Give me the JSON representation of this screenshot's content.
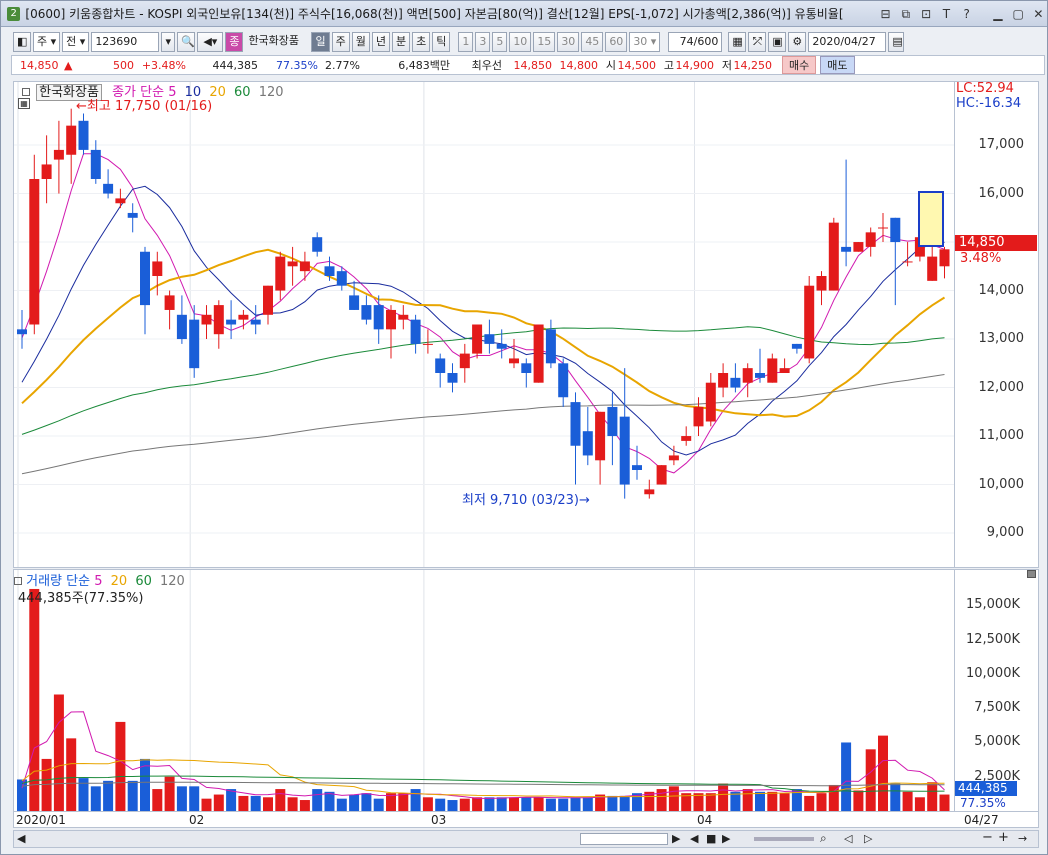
{
  "window": {
    "icon": "2",
    "title": "[0600] 키움종합차트 - KOSPI 외국인보유[134(천)] 주식수[16,068(천)] 액면[500] 자본금[80(억)] 결산[12월] EPS[-1,072] 시가총액[2,386(억)] 유통비율[",
    "controls": [
      "⊟",
      "⧉",
      "⊡",
      "T",
      "?",
      "▭",
      "▭",
      "✕"
    ]
  },
  "toolbar": {
    "market": "주",
    "prev": "전",
    "code": "123690",
    "stock_name": "한국화장품",
    "badge": "종",
    "periods": [
      "일",
      "주",
      "월",
      "년",
      "분",
      "초",
      "틱"
    ],
    "active_period": "일",
    "intervals": [
      "1",
      "3",
      "5",
      "10",
      "15",
      "30",
      "45",
      "60"
    ],
    "interval_value": "30",
    "count": "74",
    "count_total": "/600",
    "date": "2020/04/27"
  },
  "quote": {
    "price": "14,850",
    "change_arrow": "▲",
    "change": "500",
    "change_pct": "+3.48%",
    "volume": "444,385",
    "vol_ratio": "77.35%",
    "turnover": "2.77%",
    "amount": "6,483백만",
    "best_ask_label": "최우선",
    "best_ask": "14,850",
    "best_bid": "14,800",
    "open_label": "시",
    "open": "14,500",
    "high_label": "고",
    "high": "14,900",
    "low_label": "저",
    "low": "14,250",
    "buy": "매수",
    "sell": "매도"
  },
  "legend": {
    "stock": "한국화장품",
    "close_label": "종가 단순",
    "ma": [
      "5",
      "10",
      "20",
      "60",
      "120"
    ],
    "vol_label": "거래량 단순",
    "vol_ma": [
      "5",
      "20",
      "60",
      "120"
    ],
    "vol_now": "444,385주(77.35%)"
  },
  "annotations": {
    "high": "최고 17,750 (01/16)",
    "low": "최저 9,710 (03/23)",
    "lc": "LC:52.94",
    "hc": "HC:-16.34",
    "price_tag": "14,850",
    "pct_tag": "3.48%",
    "vol_tag": "444,385",
    "vol_pct_tag": "77.35%"
  },
  "price_axis": [
    "17,000",
    "16,000",
    "15,000",
    "14,000",
    "13,000",
    "12,000",
    "11,000",
    "10,000",
    "9,000"
  ],
  "volume_axis": [
    "15,000K",
    "12,500K",
    "10,000K",
    "7,500K",
    "5,000K",
    "2,500K"
  ],
  "x_axis": [
    "2020/01",
    "02",
    "03",
    "04",
    "04/27"
  ],
  "colors": {
    "up": "#e31b1b",
    "down": "#1a5ed8",
    "ma5": "#d11ab0",
    "ma10": "#1a2c9e",
    "ma20": "#e8a500",
    "ma60": "#1b8a3a",
    "ma120": "#777777"
  },
  "chart_data": {
    "type": "candlestick",
    "x_start": "2020/01/02",
    "x_end": "2020/04/27",
    "ylim": [
      8300,
      18300
    ],
    "series": [
      {
        "name": "한국화장품",
        "ohlc": [
          [
            13200,
            13600,
            12800,
            13100
          ],
          [
            13300,
            16800,
            13100,
            16300
          ],
          [
            16300,
            17200,
            15800,
            16600
          ],
          [
            16700,
            17500,
            16000,
            16900
          ],
          [
            16800,
            17750,
            16200,
            17400
          ],
          [
            17500,
            17650,
            16800,
            16900
          ],
          [
            16900,
            17100,
            16200,
            16300
          ],
          [
            16200,
            16500,
            15900,
            16000
          ],
          [
            15800,
            16100,
            15700,
            15900
          ],
          [
            15600,
            15800,
            15200,
            15500
          ],
          [
            14800,
            14900,
            13100,
            13700
          ],
          [
            14300,
            14800,
            13900,
            14600
          ],
          [
            13600,
            14000,
            13200,
            13900
          ],
          [
            13500,
            13900,
            12900,
            13000
          ],
          [
            13400,
            13700,
            12200,
            12400
          ],
          [
            13300,
            13700,
            13000,
            13500
          ],
          [
            13100,
            13800,
            12800,
            13700
          ],
          [
            13400,
            13800,
            13000,
            13300
          ],
          [
            13400,
            13600,
            13200,
            13500
          ],
          [
            13400,
            13700,
            13100,
            13300
          ],
          [
            13500,
            14100,
            13300,
            14100
          ],
          [
            14000,
            14800,
            13800,
            14700
          ],
          [
            14500,
            14900,
            14100,
            14600
          ],
          [
            14400,
            14800,
            14200,
            14600
          ],
          [
            15100,
            15200,
            14700,
            14800
          ],
          [
            14500,
            14700,
            14200,
            14300
          ],
          [
            14400,
            14500,
            14000,
            14100
          ],
          [
            13900,
            14200,
            13600,
            13600
          ],
          [
            13700,
            13900,
            13300,
            13400
          ],
          [
            13700,
            13900,
            12900,
            13200
          ],
          [
            13200,
            13700,
            12600,
            13600
          ],
          [
            13400,
            13700,
            13200,
            13500
          ],
          [
            13400,
            13500,
            12700,
            12900
          ],
          [
            12900,
            13200,
            12700,
            12900
          ],
          [
            12600,
            12700,
            12000,
            12300
          ],
          [
            12300,
            12500,
            11900,
            12100
          ],
          [
            12400,
            12900,
            12100,
            12700
          ],
          [
            12700,
            13300,
            12600,
            13300
          ],
          [
            13100,
            13400,
            12700,
            12900
          ],
          [
            12900,
            13200,
            12600,
            12800
          ],
          [
            12500,
            13000,
            12400,
            12600
          ],
          [
            12500,
            12600,
            12000,
            12300
          ],
          [
            12100,
            13300,
            12100,
            13300
          ],
          [
            13200,
            13400,
            12400,
            12500
          ],
          [
            12500,
            12600,
            11600,
            11800
          ],
          [
            11700,
            11900,
            10000,
            10800
          ],
          [
            11100,
            11600,
            10400,
            10600
          ],
          [
            10500,
            11500,
            10000,
            11500
          ],
          [
            11600,
            11900,
            10400,
            11000
          ],
          [
            11400,
            12400,
            9710,
            10000
          ],
          [
            10400,
            10800,
            10100,
            10300
          ],
          [
            9800,
            10100,
            9710,
            9900
          ],
          [
            10000,
            10400,
            10000,
            10400
          ],
          [
            10500,
            10800,
            10400,
            10600
          ],
          [
            10900,
            11200,
            10800,
            11000
          ],
          [
            11200,
            11800,
            11000,
            11600
          ],
          [
            11300,
            12300,
            11200,
            12100
          ],
          [
            12000,
            12500,
            11800,
            12300
          ],
          [
            12200,
            12500,
            11900,
            12000
          ],
          [
            12100,
            12500,
            11800,
            12400
          ],
          [
            12300,
            12800,
            12100,
            12200
          ],
          [
            12100,
            12700,
            12100,
            12600
          ],
          [
            12300,
            12600,
            12300,
            12400
          ],
          [
            12900,
            12900,
            12700,
            12800
          ],
          [
            12600,
            14300,
            12500,
            14100
          ],
          [
            14000,
            14400,
            13700,
            14300
          ],
          [
            14000,
            15500,
            14000,
            15400
          ],
          [
            14900,
            16700,
            14500,
            14800
          ],
          [
            14800,
            15000,
            14800,
            15000
          ],
          [
            14900,
            15300,
            14700,
            15200
          ],
          [
            15300,
            15600,
            15000,
            15300
          ],
          [
            15500,
            15500,
            13700,
            15000
          ],
          [
            14600,
            15000,
            14500,
            14600
          ],
          [
            14700,
            15100,
            14600,
            15100
          ],
          [
            14200,
            15000,
            14200,
            14700
          ],
          [
            14500,
            14900,
            14250,
            14850
          ]
        ]
      }
    ],
    "volume_k": [
      2300,
      16200,
      3800,
      8500,
      5300,
      2400,
      1800,
      2200,
      6500,
      2200,
      3800,
      1600,
      2500,
      1800,
      1800,
      900,
      1200,
      1600,
      1100,
      1100,
      1000,
      1600,
      1000,
      800,
      1600,
      1400,
      900,
      1200,
      1300,
      900,
      1300,
      1300,
      1600,
      1000,
      900,
      800,
      900,
      1000,
      1000,
      1000,
      1000,
      1000,
      1000,
      900,
      900,
      1000,
      1000,
      1200,
      1100,
      1100,
      1300,
      1400,
      1600,
      1800,
      1300,
      1300,
      1300,
      2000,
      1400,
      1600,
      1400,
      1400,
      1300,
      1600,
      1100,
      1300,
      1900,
      5000,
      1500,
      4500,
      5500,
      2000,
      1400,
      1000,
      2100,
      1200,
      1500,
      2000,
      1800,
      1400,
      450
    ]
  }
}
